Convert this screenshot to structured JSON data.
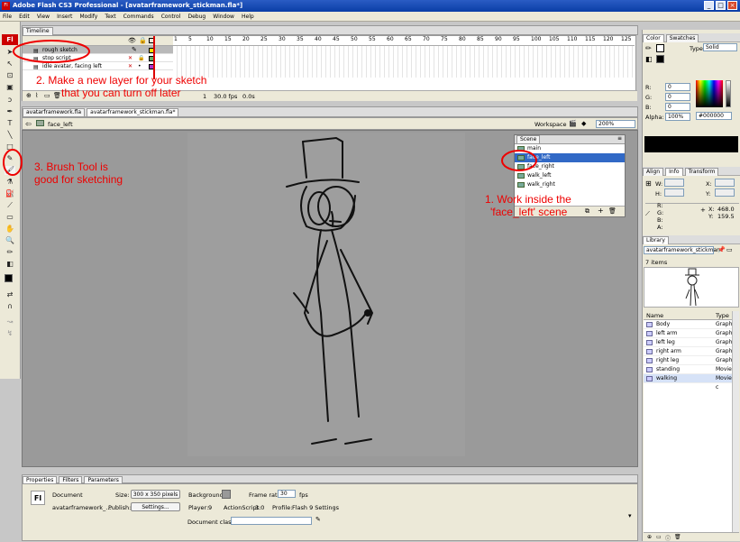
{
  "window": {
    "title": "Adobe Flash CS3 Professional - [avatarframework_stickman.fla*]",
    "logo": "Fl"
  },
  "menu": [
    "File",
    "Edit",
    "View",
    "Insert",
    "Modify",
    "Text",
    "Commands",
    "Control",
    "Debug",
    "Window",
    "Help"
  ],
  "toolbar": {
    "logo": "Fl"
  },
  "timeline": {
    "tab": "Timeline",
    "layers": [
      {
        "name": "rough sketch"
      },
      {
        "name": "stop script"
      },
      {
        "name": "idle avatar, facing left"
      }
    ],
    "ruler": [
      "1",
      "5",
      "10",
      "15",
      "20",
      "25",
      "30",
      "35",
      "40",
      "45",
      "50",
      "55",
      "60",
      "65",
      "70",
      "75",
      "80",
      "85",
      "90",
      "95",
      "100",
      "105",
      "110",
      "115",
      "120",
      "125"
    ],
    "frame": "1",
    "fps": "30.0 fps",
    "time": "0.0s"
  },
  "document": {
    "tabs": [
      "avatarframework.fla",
      "avatarframework_stickman.fla*"
    ],
    "scene_label": "face_left",
    "workspace": "Workspace",
    "zoom": "200%"
  },
  "scene_panel": {
    "title": "Scene",
    "items": [
      "main",
      "face_left",
      "face_right",
      "walk_left",
      "walk_right"
    ],
    "selected_index": 1
  },
  "annotations": {
    "note2a": "2. Make a new layer for your sketch",
    "note2b": "that you can turn off later",
    "note3a": "3. Brush Tool is",
    "note3b": "good for sketching",
    "note1a": "1. Work inside the",
    "note1b": "'face_left' scene"
  },
  "color_panel": {
    "tabs": [
      "Color",
      "Swatches"
    ],
    "type_label": "Type:",
    "type_value": "Solid",
    "r_label": "R:",
    "r": "0",
    "g_label": "G:",
    "g": "0",
    "b_label": "B:",
    "b": "0",
    "alpha_label": "Alpha:",
    "alpha": "100%",
    "hex": "#000000"
  },
  "info_panel": {
    "tabs": [
      "Align",
      "Info",
      "Transform"
    ],
    "w_label": "W:",
    "h_label": "H:",
    "x_label": "X:",
    "y_label": "Y:",
    "r_label": "R:",
    "g_label": "G:",
    "b_label": "B:",
    "a_label": "A:",
    "x": "468.0",
    "y": "159.5"
  },
  "library": {
    "tab": "Library",
    "file": "avatarframework_stickman",
    "count": "7 items",
    "col_name": "Name",
    "col_type": "Type",
    "items": [
      {
        "name": "Body",
        "type": "Graphic"
      },
      {
        "name": "left arm",
        "type": "Graphic"
      },
      {
        "name": "left leg",
        "type": "Graphic"
      },
      {
        "name": "right arm",
        "type": "Graphic"
      },
      {
        "name": "right leg",
        "type": "Graphic"
      },
      {
        "name": "standing",
        "type": "Movie C"
      },
      {
        "name": "walking",
        "type": "Movie c"
      }
    ]
  },
  "properties": {
    "tabs": [
      "Properties",
      "Filters",
      "Parameters"
    ],
    "doc_label": "Document",
    "doc_name": "avatarframework_...",
    "size_label": "Size:",
    "size": "300 x 350 pixels",
    "bg_label": "Background:",
    "fr_label": "Frame rate:",
    "fr": "30",
    "fps_unit": "fps",
    "publish_label": "Publish:",
    "settings": "Settings...",
    "player_label": "Player:",
    "player": "9",
    "as_label": "ActionScript:",
    "as": "3.0",
    "profile_label": "Profile:",
    "profile": "Flash 9 Settings",
    "class_label": "Document class:",
    "class": ""
  },
  "colors": {
    "annotation": "#e00000",
    "selection": "#3169c6",
    "titlebar": "#0a3ea6"
  }
}
